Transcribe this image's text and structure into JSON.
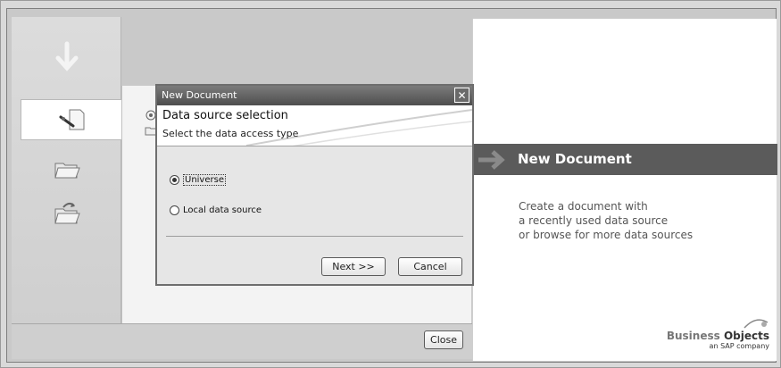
{
  "dialog": {
    "title": "New Document",
    "header_title": "Data source selection",
    "header_subtitle": "Select the data access type",
    "options": [
      {
        "label": "Universe",
        "selected": true
      },
      {
        "label": "Local data source",
        "selected": false
      }
    ],
    "next_label": "Next >>",
    "cancel_label": "Cancel",
    "close_icon": "close-icon"
  },
  "bottom": {
    "close_label": "Close"
  },
  "welcome": {
    "title": "New Document",
    "lines": [
      "Create a document with",
      "a recently used data source",
      "or browse for more data sources"
    ]
  },
  "brand": {
    "name_part1": "Business",
    "name_part2": "Objects",
    "tagline": "an SAP company"
  },
  "nav": {
    "icons": [
      "down-arrow-icon",
      "new-document-icon",
      "open-folder-icon",
      "recent-folder-icon"
    ]
  },
  "colors": {
    "title_band": "#5b5b5b",
    "dialog_titlebar": "#4e4e4e"
  }
}
